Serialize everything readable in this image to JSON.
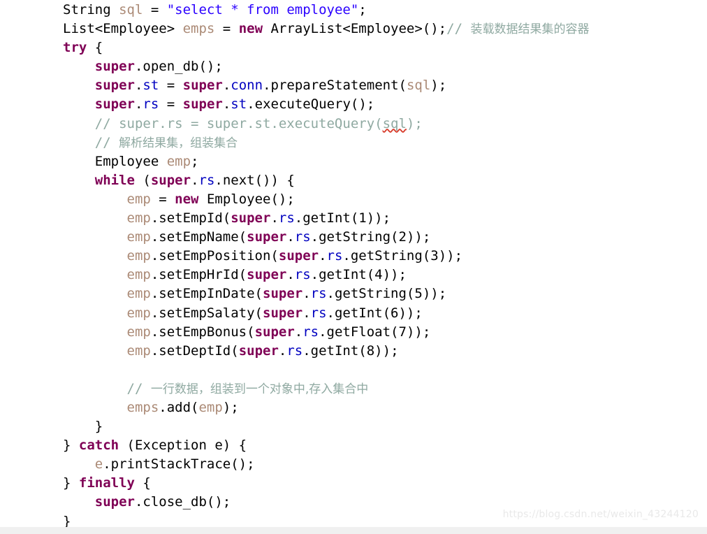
{
  "editor": {
    "language": "Java",
    "background_color": "#ffffff",
    "font_size_px": 19,
    "line_height_px": 27.1,
    "colors": {
      "default_text": "#000000",
      "keyword": "#7f0055",
      "string": "#2a00ff",
      "comment": "#8fa9a1",
      "field": "#0000c0",
      "local_variable": "#ab8a76",
      "spellcheck_underline": "#d83b2a"
    }
  },
  "watermark": {
    "text": "https://blog.csdn.net/weixin_43244120",
    "color": "#e9e9e9"
  },
  "code": {
    "lines": [
      {
        "index": 1,
        "indent": 0,
        "tokens": [
          {
            "kind": "plain",
            "text": "String "
          },
          {
            "kind": "local",
            "text": "sql"
          },
          {
            "kind": "plain",
            "text": " = "
          },
          {
            "kind": "string",
            "text": "\"select * from employee\""
          },
          {
            "kind": "plain",
            "text": ";"
          }
        ]
      },
      {
        "index": 2,
        "indent": 0,
        "tokens": [
          {
            "kind": "plain",
            "text": "List<Employee> "
          },
          {
            "kind": "local",
            "text": "emps"
          },
          {
            "kind": "plain",
            "text": " = "
          },
          {
            "kind": "keyword",
            "text": "new"
          },
          {
            "kind": "plain",
            "text": " ArrayList<Employee>();"
          },
          {
            "kind": "comment",
            "text": "// "
          },
          {
            "kind": "comment-cjk",
            "text": "装载数据结果集的容器"
          }
        ]
      },
      {
        "index": 3,
        "indent": 0,
        "tokens": [
          {
            "kind": "keyword",
            "text": "try"
          },
          {
            "kind": "plain",
            "text": " {"
          }
        ]
      },
      {
        "index": 4,
        "indent": 1,
        "tokens": [
          {
            "kind": "keyword",
            "text": "super"
          },
          {
            "kind": "plain",
            "text": ".open_db();"
          }
        ]
      },
      {
        "index": 5,
        "indent": 1,
        "tokens": [
          {
            "kind": "keyword",
            "text": "super"
          },
          {
            "kind": "plain",
            "text": "."
          },
          {
            "kind": "field",
            "text": "st"
          },
          {
            "kind": "plain",
            "text": " = "
          },
          {
            "kind": "keyword",
            "text": "super"
          },
          {
            "kind": "plain",
            "text": "."
          },
          {
            "kind": "field",
            "text": "conn"
          },
          {
            "kind": "plain",
            "text": ".prepareStatement("
          },
          {
            "kind": "local",
            "text": "sql"
          },
          {
            "kind": "plain",
            "text": ");"
          }
        ]
      },
      {
        "index": 6,
        "indent": 1,
        "tokens": [
          {
            "kind": "keyword",
            "text": "super"
          },
          {
            "kind": "plain",
            "text": "."
          },
          {
            "kind": "field",
            "text": "rs"
          },
          {
            "kind": "plain",
            "text": " = "
          },
          {
            "kind": "keyword",
            "text": "super"
          },
          {
            "kind": "plain",
            "text": "."
          },
          {
            "kind": "field",
            "text": "st"
          },
          {
            "kind": "plain",
            "text": ".executeQuery();"
          }
        ]
      },
      {
        "index": 7,
        "indent": 1,
        "tokens": [
          {
            "kind": "comment",
            "text": "// super.rs = super.st.executeQuery("
          },
          {
            "kind": "comment-spell",
            "text": "sql"
          },
          {
            "kind": "comment",
            "text": ");"
          }
        ]
      },
      {
        "index": 8,
        "indent": 1,
        "tokens": [
          {
            "kind": "comment",
            "text": "// "
          },
          {
            "kind": "comment-cjk",
            "text": "解析结果集，组装集合"
          }
        ]
      },
      {
        "index": 9,
        "indent": 1,
        "tokens": [
          {
            "kind": "plain",
            "text": "Employee "
          },
          {
            "kind": "local",
            "text": "emp"
          },
          {
            "kind": "plain",
            "text": ";"
          }
        ]
      },
      {
        "index": 10,
        "indent": 1,
        "tokens": [
          {
            "kind": "keyword",
            "text": "while"
          },
          {
            "kind": "plain",
            "text": " ("
          },
          {
            "kind": "keyword",
            "text": "super"
          },
          {
            "kind": "plain",
            "text": "."
          },
          {
            "kind": "field",
            "text": "rs"
          },
          {
            "kind": "plain",
            "text": ".next()) {"
          }
        ]
      },
      {
        "index": 11,
        "indent": 2,
        "tokens": [
          {
            "kind": "local",
            "text": "emp"
          },
          {
            "kind": "plain",
            "text": " = "
          },
          {
            "kind": "keyword",
            "text": "new"
          },
          {
            "kind": "plain",
            "text": " Employee();"
          }
        ]
      },
      {
        "index": 12,
        "indent": 2,
        "tokens": [
          {
            "kind": "local",
            "text": "emp"
          },
          {
            "kind": "plain",
            "text": ".setEmpId("
          },
          {
            "kind": "keyword",
            "text": "super"
          },
          {
            "kind": "plain",
            "text": "."
          },
          {
            "kind": "field",
            "text": "rs"
          },
          {
            "kind": "plain",
            "text": ".getInt(1));"
          }
        ]
      },
      {
        "index": 13,
        "indent": 2,
        "tokens": [
          {
            "kind": "local",
            "text": "emp"
          },
          {
            "kind": "plain",
            "text": ".setEmpName("
          },
          {
            "kind": "keyword",
            "text": "super"
          },
          {
            "kind": "plain",
            "text": "."
          },
          {
            "kind": "field",
            "text": "rs"
          },
          {
            "kind": "plain",
            "text": ".getString(2));"
          }
        ]
      },
      {
        "index": 14,
        "indent": 2,
        "tokens": [
          {
            "kind": "local",
            "text": "emp"
          },
          {
            "kind": "plain",
            "text": ".setEmpPosition("
          },
          {
            "kind": "keyword",
            "text": "super"
          },
          {
            "kind": "plain",
            "text": "."
          },
          {
            "kind": "field",
            "text": "rs"
          },
          {
            "kind": "plain",
            "text": ".getString(3));"
          }
        ]
      },
      {
        "index": 15,
        "indent": 2,
        "tokens": [
          {
            "kind": "local",
            "text": "emp"
          },
          {
            "kind": "plain",
            "text": ".setEmpHrId("
          },
          {
            "kind": "keyword",
            "text": "super"
          },
          {
            "kind": "plain",
            "text": "."
          },
          {
            "kind": "field",
            "text": "rs"
          },
          {
            "kind": "plain",
            "text": ".getInt(4));"
          }
        ]
      },
      {
        "index": 16,
        "indent": 2,
        "tokens": [
          {
            "kind": "local",
            "text": "emp"
          },
          {
            "kind": "plain",
            "text": ".setEmpInDate("
          },
          {
            "kind": "keyword",
            "text": "super"
          },
          {
            "kind": "plain",
            "text": "."
          },
          {
            "kind": "field",
            "text": "rs"
          },
          {
            "kind": "plain",
            "text": ".getString(5));"
          }
        ]
      },
      {
        "index": 17,
        "indent": 2,
        "tokens": [
          {
            "kind": "local",
            "text": "emp"
          },
          {
            "kind": "plain",
            "text": ".setEmpSalaty("
          },
          {
            "kind": "keyword",
            "text": "super"
          },
          {
            "kind": "plain",
            "text": "."
          },
          {
            "kind": "field",
            "text": "rs"
          },
          {
            "kind": "plain",
            "text": ".getInt(6));"
          }
        ]
      },
      {
        "index": 18,
        "indent": 2,
        "tokens": [
          {
            "kind": "local",
            "text": "emp"
          },
          {
            "kind": "plain",
            "text": ".setEmpBonus("
          },
          {
            "kind": "keyword",
            "text": "super"
          },
          {
            "kind": "plain",
            "text": "."
          },
          {
            "kind": "field",
            "text": "rs"
          },
          {
            "kind": "plain",
            "text": ".getFloat(7));"
          }
        ]
      },
      {
        "index": 19,
        "indent": 2,
        "tokens": [
          {
            "kind": "local",
            "text": "emp"
          },
          {
            "kind": "plain",
            "text": ".setDeptId("
          },
          {
            "kind": "keyword",
            "text": "super"
          },
          {
            "kind": "plain",
            "text": "."
          },
          {
            "kind": "field",
            "text": "rs"
          },
          {
            "kind": "plain",
            "text": ".getInt(8));"
          }
        ]
      },
      {
        "index": 20,
        "indent": 0,
        "tokens": []
      },
      {
        "index": 21,
        "indent": 2,
        "tokens": [
          {
            "kind": "comment",
            "text": "// "
          },
          {
            "kind": "comment-cjk",
            "text": "一行数据，组装到一个对象中,存入集合中"
          }
        ]
      },
      {
        "index": 22,
        "indent": 2,
        "tokens": [
          {
            "kind": "local",
            "text": "emps"
          },
          {
            "kind": "plain",
            "text": ".add("
          },
          {
            "kind": "local",
            "text": "emp"
          },
          {
            "kind": "plain",
            "text": ");"
          }
        ]
      },
      {
        "index": 23,
        "indent": 1,
        "tokens": [
          {
            "kind": "plain",
            "text": "}"
          }
        ]
      },
      {
        "index": 24,
        "indent": 0,
        "tokens": [
          {
            "kind": "plain",
            "text": "} "
          },
          {
            "kind": "keyword",
            "text": "catch"
          },
          {
            "kind": "plain",
            "text": " (Exception e) {"
          }
        ]
      },
      {
        "index": 25,
        "indent": 1,
        "tokens": [
          {
            "kind": "local",
            "text": "e"
          },
          {
            "kind": "plain",
            "text": ".printStackTrace();"
          }
        ]
      },
      {
        "index": 26,
        "indent": 0,
        "tokens": [
          {
            "kind": "plain",
            "text": "} "
          },
          {
            "kind": "keyword",
            "text": "finally"
          },
          {
            "kind": "plain",
            "text": " {"
          }
        ]
      },
      {
        "index": 27,
        "indent": 1,
        "tokens": [
          {
            "kind": "keyword",
            "text": "super"
          },
          {
            "kind": "plain",
            "text": ".close_db();"
          }
        ]
      },
      {
        "index": 28,
        "indent": 0,
        "tokens": [
          {
            "kind": "plain",
            "text": "}"
          }
        ]
      }
    ]
  }
}
